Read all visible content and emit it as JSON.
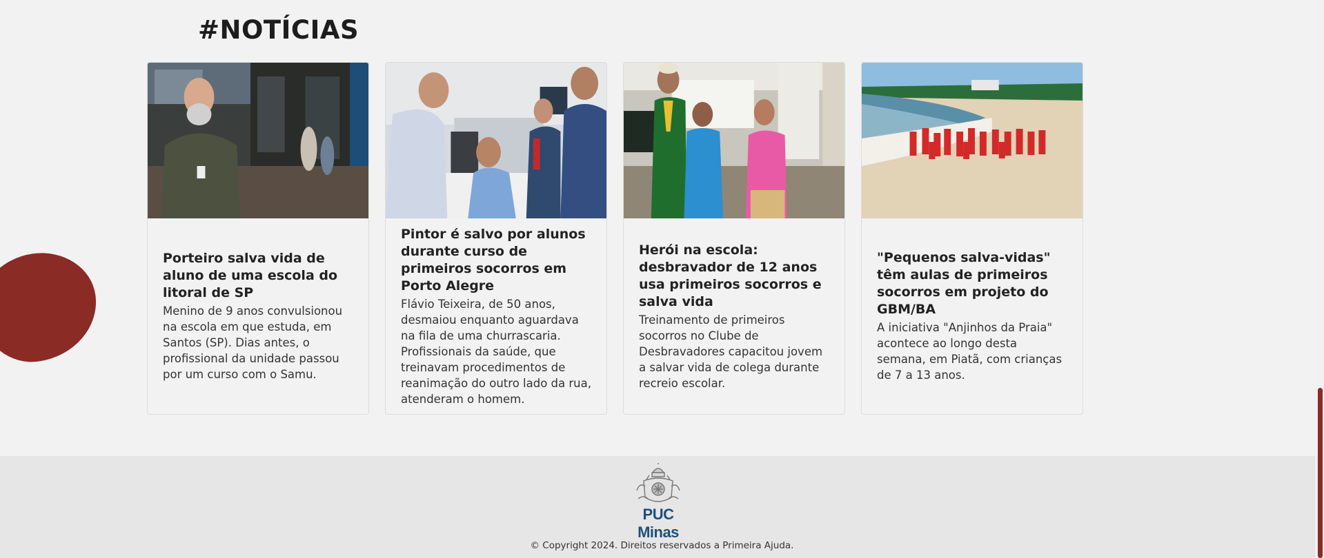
{
  "section": {
    "title": "#NOTÍCIAS"
  },
  "news": [
    {
      "title": "Porteiro salva vida de aluno de uma escola do litoral de SP",
      "text": "Menino de 9 anos convulsionou na escola em que estuda, em Santos (SP). Dias antes, o profissional da unidade passou por um curso com o Samu."
    },
    {
      "title": "Pintor é salvo por alunos durante curso de primeiros socorros em Porto Alegre",
      "text": "Flávio Teixeira, de 50 anos, desmaiou enquanto aguardava na fila de uma churrascaria. Profissionais da saúde, que treinavam procedimentos de reanimação do outro lado da rua, atenderam o homem."
    },
    {
      "title": "Herói na escola: desbravador de 12 anos usa primeiros socorros e salva vida",
      "text": "Treinamento de primeiros socorros no Clube de Desbravadores capacitou jovem a salvar vida de colega durante recreio escolar."
    },
    {
      "title": "\"Pequenos salva-vidas\" têm aulas de primeiros socorros em projeto do GBM/BA",
      "text": "A iniciativa \"Anjinhos da Praia\" acontece ao longo desta semana, em Piatã, com crianças de 7 a 13 anos."
    }
  ],
  "footer": {
    "logo_text": "PUC Minas",
    "copyright": "© Copyright 2024. Direitos reservados a Primeira Ajuda."
  },
  "colors": {
    "accent": "#8b2b25",
    "background": "#f1f2f1",
    "footer_bg": "#e6e6e6",
    "logo_blue": "#1f4f7a"
  }
}
